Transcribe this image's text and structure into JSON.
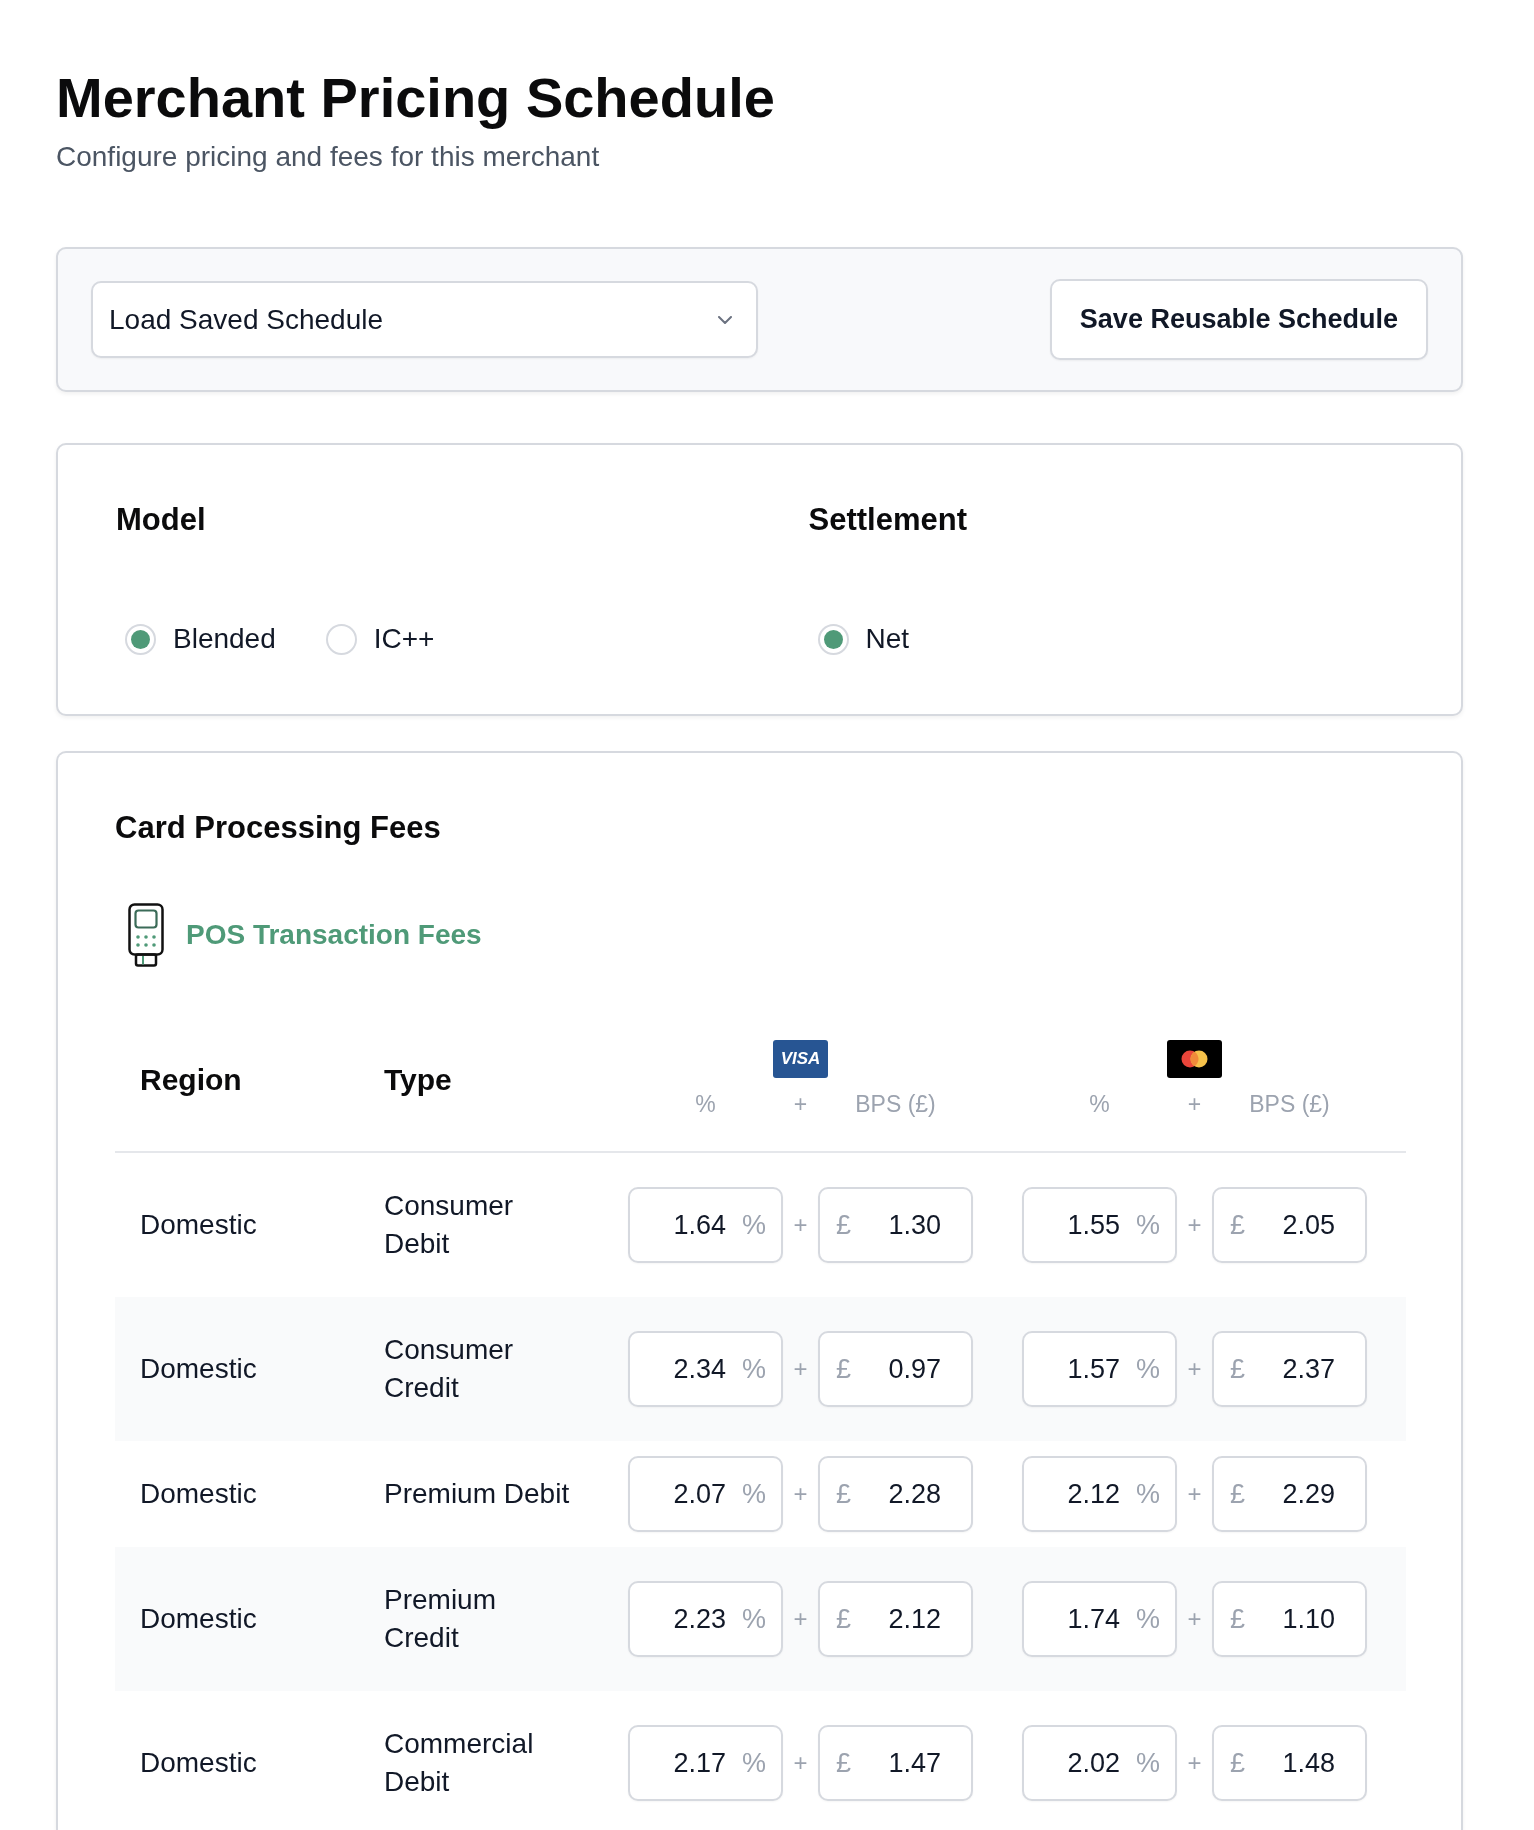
{
  "page": {
    "title": "Merchant Pricing Schedule",
    "subtitle": "Configure pricing and fees for this merchant"
  },
  "schedule_bar": {
    "load_select": {
      "value": "Load Saved Schedule"
    },
    "save_button": "Save Reusable Schedule"
  },
  "pricing_options": [
    {
      "title": "Model",
      "options": [
        {
          "label": "Blended",
          "selected": true
        },
        {
          "label": "IC++",
          "selected": false
        }
      ]
    },
    {
      "title": "Settlement",
      "options": [
        {
          "label": "Net",
          "selected": true
        }
      ]
    }
  ],
  "card_processing_fees": {
    "title": "Card Processing Fees",
    "section": {
      "title": "POS Transaction Fees"
    },
    "table": {
      "columns": {
        "region": "Region",
        "type": "Type",
        "schemes": [
          {
            "kind": "visa",
            "logo_text": "VISA",
            "subheaders": [
              "%",
              "+",
              "BPS (£)"
            ]
          },
          {
            "kind": "mastercard",
            "subheaders": [
              "%",
              "+",
              "BPS (£)"
            ]
          }
        ]
      },
      "rows": [
        {
          "region": "Domestic",
          "type": "Consumer Debit",
          "fees": [
            {
              "percent": "1.64",
              "unit": "%",
              "plus": "+",
              "currency": "£",
              "bps": "1.30"
            },
            {
              "percent": "1.55",
              "unit": "%",
              "plus": "+",
              "currency": "£",
              "bps": "2.05"
            }
          ]
        },
        {
          "region": "Domestic",
          "type": "Consumer Credit",
          "fees": [
            {
              "percent": "2.34",
              "unit": "%",
              "plus": "+",
              "currency": "£",
              "bps": "0.97"
            },
            {
              "percent": "1.57",
              "unit": "%",
              "plus": "+",
              "currency": "£",
              "bps": "2.37"
            }
          ]
        },
        {
          "region": "Domestic",
          "type": "Premium Debit",
          "fees": [
            {
              "percent": "2.07",
              "unit": "%",
              "plus": "+",
              "currency": "£",
              "bps": "2.28"
            },
            {
              "percent": "2.12",
              "unit": "%",
              "plus": "+",
              "currency": "£",
              "bps": "2.29"
            }
          ]
        },
        {
          "region": "Domestic",
          "type": "Premium Credit",
          "fees": [
            {
              "percent": "2.23",
              "unit": "%",
              "plus": "+",
              "currency": "£",
              "bps": "2.12"
            },
            {
              "percent": "1.74",
              "unit": "%",
              "plus": "+",
              "currency": "£",
              "bps": "1.10"
            }
          ]
        },
        {
          "region": "Domestic",
          "type": "Commercial Debit",
          "fees": [
            {
              "percent": "2.17",
              "unit": "%",
              "plus": "+",
              "currency": "£",
              "bps": "1.47"
            },
            {
              "percent": "2.02",
              "unit": "%",
              "plus": "+",
              "currency": "£",
              "bps": "1.48"
            }
          ]
        }
      ]
    }
  }
}
